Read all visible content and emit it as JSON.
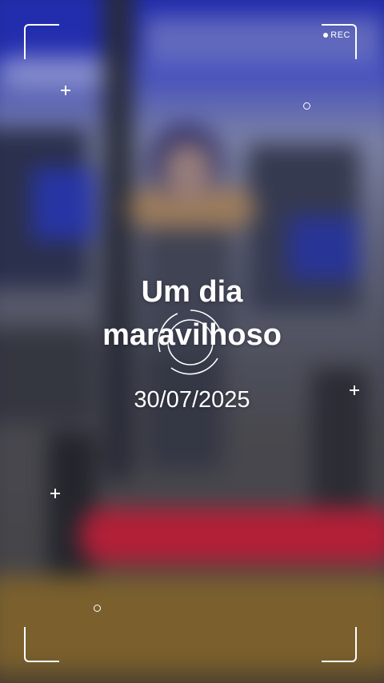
{
  "viewfinder": {
    "rec_label": "REC",
    "icons": [
      "rec-dot-icon",
      "plus-icon",
      "ring-icon",
      "focus-circle-icon",
      "corner-bracket-icon"
    ]
  },
  "caption": {
    "line1": "Um dia",
    "line2": "maravilhoso",
    "date": "30/07/2025"
  },
  "colors": {
    "text": "#ffffff",
    "ceiling_blue": "#2a34c8",
    "accent_red": "#c8213a"
  }
}
